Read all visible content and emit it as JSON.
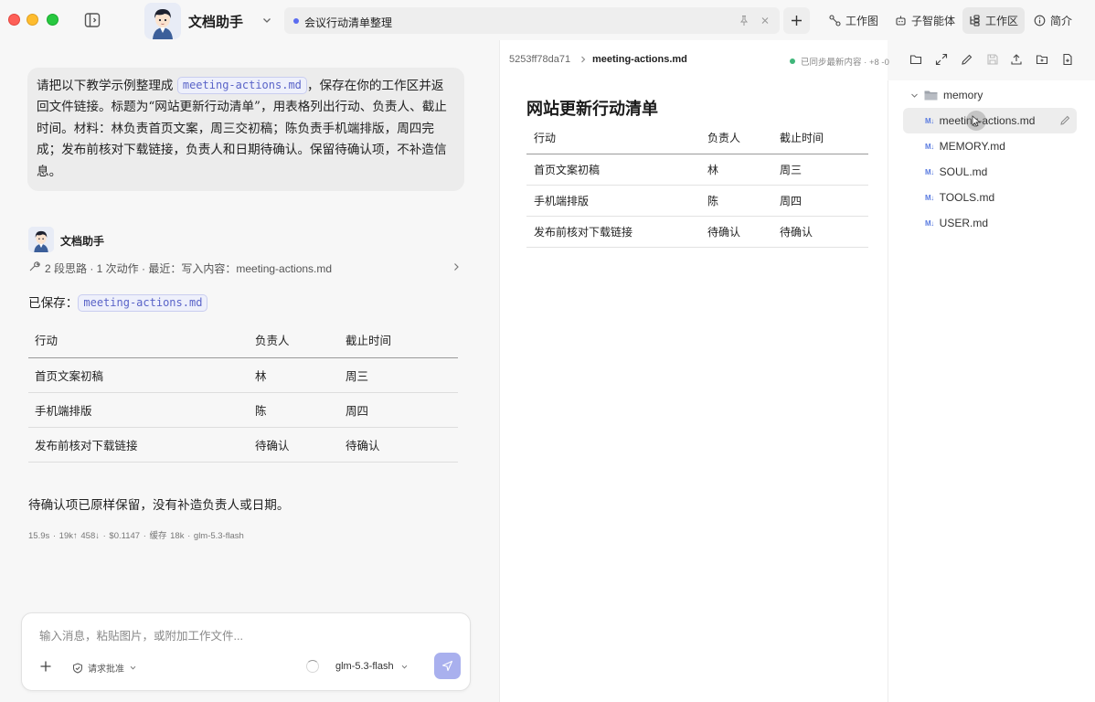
{
  "titlebar": {
    "agent_name": "文档助手",
    "session_title": "会议行动清单整理",
    "nav": [
      {
        "label": "工作图",
        "icon": "graph-icon",
        "active": false
      },
      {
        "label": "子智能体",
        "icon": "robot-icon",
        "active": false
      },
      {
        "label": "工作区",
        "icon": "workspace-icon",
        "active": true
      },
      {
        "label": "简介",
        "icon": "info-icon",
        "active": false
      }
    ]
  },
  "chat": {
    "user_message_before": "请把以下教学示例整理成 ",
    "user_message_chip": "meeting-actions.md",
    "user_message_after": "，保存在你的工作区并返回文件链接。标题为“网站更新行动清单”，用表格列出行动、负责人、截止时间。材料：林负责首页文案，周三交初稿；陈负责手机端排版，周四完成；发布前核对下载链接，负责人和日期待确认。保留待确认项，不补造信息。",
    "assistant_name": "文档助手",
    "trace_text": "2 段思路 · 1 次动作 · 最近：写入内容：meeting-actions.md",
    "saved_label": "已保存：",
    "saved_file": "meeting-actions.md",
    "table": {
      "headers": [
        "行动",
        "负责人",
        "截止时间"
      ],
      "rows": [
        [
          "首页文案初稿",
          "林",
          "周三"
        ],
        [
          "手机端排版",
          "陈",
          "周四"
        ],
        [
          "发布前核对下载链接",
          "待确认",
          "待确认"
        ]
      ]
    },
    "summary": "待确认项已原样保留，没有补造负责人或日期。",
    "stats": "15.9s · 19k↑ 458↓ · $0.1147 · 缓存 18k · glm-5.3-flash"
  },
  "composer": {
    "placeholder": "输入消息，粘贴图片，或附加工作文件...",
    "approval_label": "请求批准",
    "model": "glm-5.3-flash"
  },
  "editor": {
    "commit_id": "5253ff78da71",
    "file_name": "meeting-actions.md",
    "sync_status": "已同步最新内容 · +8 -0",
    "doc_title": "网站更新行动清单",
    "table": {
      "headers": [
        "行动",
        "负责人",
        "截止时间"
      ],
      "rows": [
        [
          "首页文案初稿",
          "林",
          "周三"
        ],
        [
          "手机端排版",
          "陈",
          "周四"
        ],
        [
          "发布前核对下载链接",
          "待确认",
          "待确认"
        ]
      ]
    }
  },
  "file_tree": {
    "folder": "memory",
    "md_badge": "M↓",
    "files": [
      "meeting-actions.md",
      "MEMORY.md",
      "SOUL.md",
      "TOOLS.md",
      "USER.md"
    ],
    "selected": "meeting-actions.md"
  },
  "colors": {
    "accent": "#5b6cf0",
    "send_button": "#a9b0ee",
    "sync_dot": "#3fb67a",
    "md_badge": "#5a7be0"
  }
}
